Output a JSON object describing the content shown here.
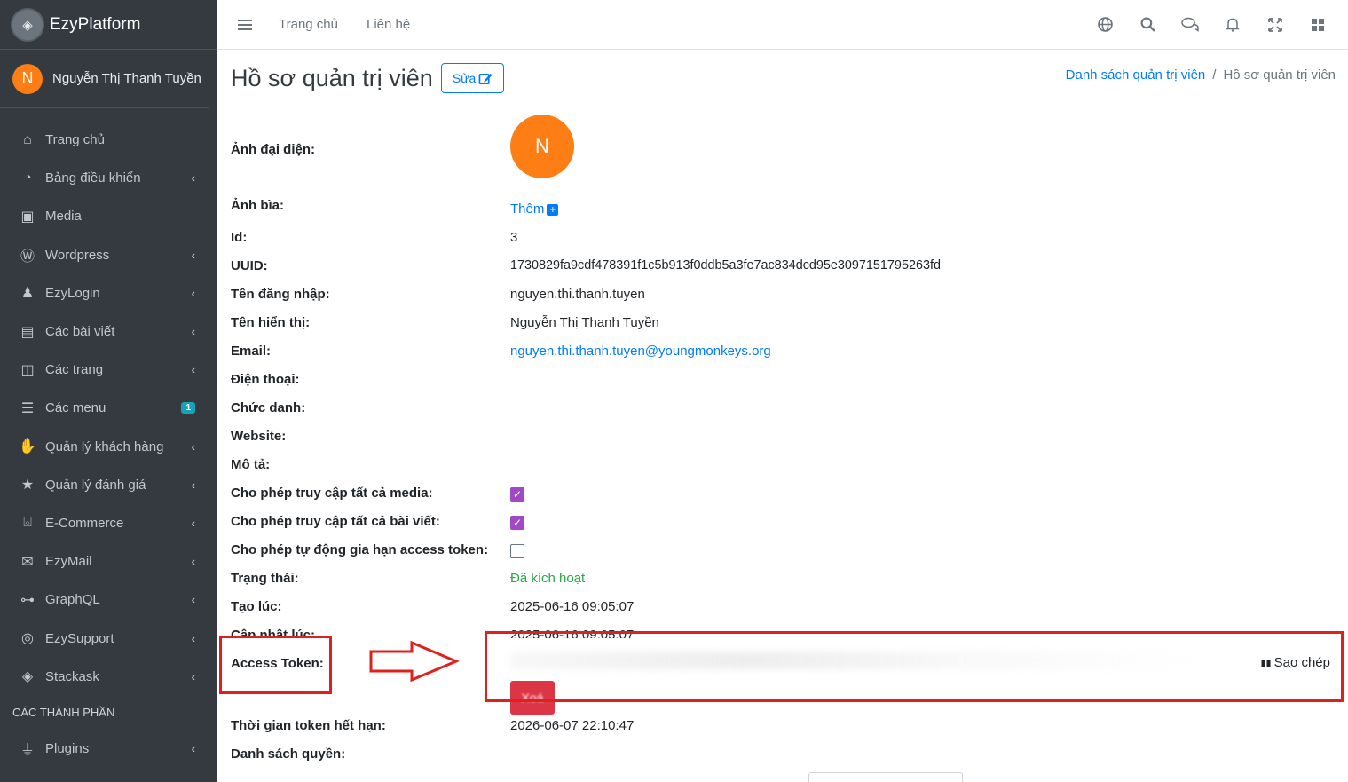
{
  "brand": {
    "name": "EzyPlatform"
  },
  "user": {
    "initial": "N",
    "name": "Nguyễn Thị Thanh Tuyền"
  },
  "sidebar": {
    "items": [
      {
        "label": "Trang chủ",
        "icon": "home-icon",
        "arrow": false
      },
      {
        "label": "Bảng điều khiển",
        "icon": "dashboard-icon",
        "arrow": true
      },
      {
        "label": "Media",
        "icon": "image-icon",
        "arrow": false
      },
      {
        "label": "Wordpress",
        "icon": "wordpress-icon",
        "arrow": true
      },
      {
        "label": "EzyLogin",
        "icon": "user-lock-icon",
        "arrow": true
      },
      {
        "label": "Các bài viết",
        "icon": "newspaper-icon",
        "arrow": true
      },
      {
        "label": "Các trang",
        "icon": "columns-icon",
        "arrow": true
      },
      {
        "label": "Các menu",
        "icon": "bars-icon",
        "badge": "1"
      },
      {
        "label": "Quản lý khách hàng",
        "icon": "handshake-icon",
        "arrow": true
      },
      {
        "label": "Quản lý đánh giá",
        "icon": "star-icon",
        "arrow": true
      },
      {
        "label": "E-Commerce",
        "icon": "basket-icon",
        "arrow": true
      },
      {
        "label": "EzyMail",
        "icon": "envelope-icon",
        "arrow": true
      },
      {
        "label": "GraphQL",
        "icon": "graph-icon",
        "arrow": true
      },
      {
        "label": "EzySupport",
        "icon": "lifebuoy-icon",
        "arrow": true
      },
      {
        "label": "Stackask",
        "icon": "layers-icon",
        "arrow": true
      }
    ],
    "section_header": "CÁC THÀNH PHẦN",
    "plugins": {
      "label": "Plugins",
      "icon": "plug-icon"
    }
  },
  "topbar": {
    "links": [
      "Trang chủ",
      "Liên hệ"
    ],
    "icons": [
      "globe-icon",
      "search-icon",
      "comments-icon",
      "bell-icon",
      "expand-icon",
      "grid-icon"
    ]
  },
  "page": {
    "title": "Hồ sơ quản trị viên",
    "edit_label": "Sửa",
    "breadcrumb": {
      "parent": "Danh sách quản trị viên",
      "separator": "/",
      "current": "Hồ sơ quản trị viên"
    }
  },
  "profile": {
    "avatar_label": "Ảnh đại diện:",
    "avatar_initial": "N",
    "cover_label": "Ảnh bìa:",
    "cover_add": "Thêm",
    "id_label": "Id:",
    "id": "3",
    "uuid_label": "UUID:",
    "uuid": "1730829fa9cdf478391f1c5b913f0ddb5a3fe7ac834dcd95e3097151795263fd",
    "username_label": "Tên đăng nhập:",
    "username": "nguyen.thi.thanh.tuyen",
    "display_label": "Tên hiển thị:",
    "display": "Nguyễn Thị Thanh Tuyền",
    "email_label": "Email:",
    "email": "nguyen.thi.thanh.tuyen@youngmonkeys.org",
    "phone_label": "Điện thoại:",
    "position_label": "Chức danh:",
    "website_label": "Website:",
    "desc_label": "Mô tả:",
    "media_label": "Cho phép truy cập tất cả media:",
    "posts_label": "Cho phép truy cập tất cả bài viết:",
    "renew_label": "Cho phép tự động gia hạn access token:",
    "status_label": "Trạng thái:",
    "status": "Đã kích hoạt",
    "created_label": "Tạo lúc:",
    "created": "2025-06-16 09:05:07",
    "updated_label": "Cập nhật lúc:",
    "updated": "2025-06-16 09:05:07",
    "token_label": "Access Token:",
    "copy_label": "Sao chép",
    "delete_label": "Xoá",
    "expire_label": "Thời gian token hết hạn:",
    "expire": "2026-06-07 22:10:47",
    "perms_label": "Danh sách quyền:"
  },
  "colors": {
    "sidebar": "#343a40",
    "accent": "#007bff",
    "avatar": "#fd7e14",
    "annotation": "#e0201c",
    "checkbox": "#a148c4"
  }
}
